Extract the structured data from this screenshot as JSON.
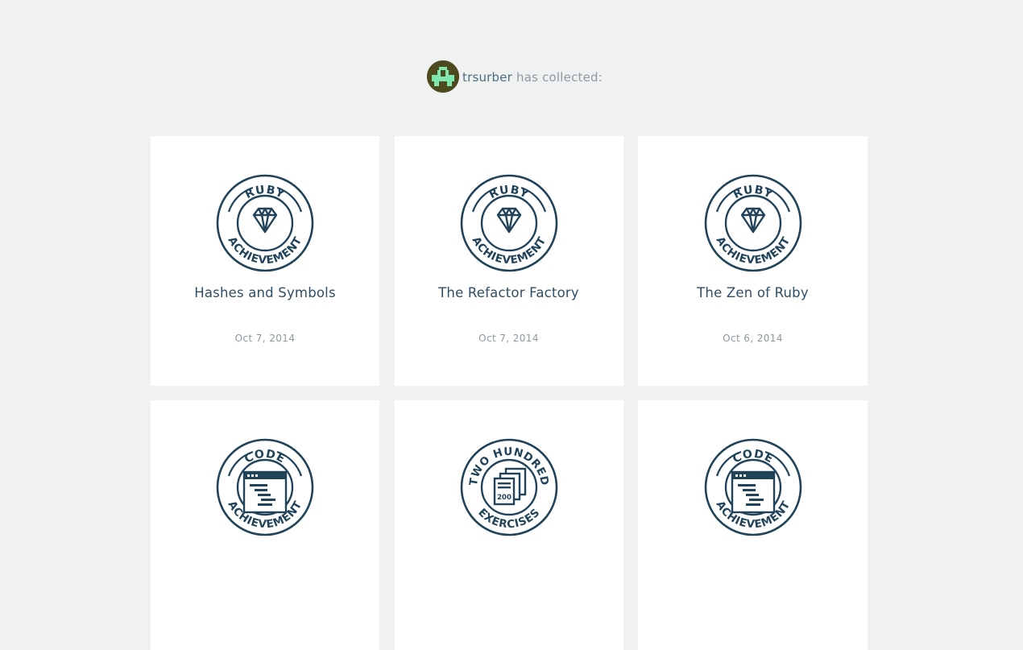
{
  "profile": {
    "username": "trsurber",
    "collected_text": "has collected:"
  },
  "colors": {
    "badge_ink": "#21435a",
    "avatar_bg": "#4c4a1e",
    "avatar_fg": "#7fe8b0",
    "page_bg": "#f0f2f1"
  },
  "achievements": [
    {
      "title": "Hashes and Symbols",
      "date": "Oct 7, 2014",
      "badge": {
        "top": "RUBY",
        "bottom": "ACHIEVEMENT",
        "icon": "diamond-icon"
      }
    },
    {
      "title": "The Refactor Factory",
      "date": "Oct 7, 2014",
      "badge": {
        "top": "RUBY",
        "bottom": "ACHIEVEMENT",
        "icon": "diamond-icon"
      }
    },
    {
      "title": "The Zen of Ruby",
      "date": "Oct 6, 2014",
      "badge": {
        "top": "RUBY",
        "bottom": "ACHIEVEMENT",
        "icon": "diamond-icon"
      }
    },
    {
      "title": "",
      "date": "",
      "badge": {
        "top": "CODE",
        "bottom": "ACHIEVEMENT",
        "icon": "code-window-icon"
      }
    },
    {
      "title": "",
      "date": "",
      "badge": {
        "top": "TWO HUNDRED",
        "bottom": "EXERCISES",
        "icon": "stacked-exercises-icon",
        "number": "200"
      }
    },
    {
      "title": "",
      "date": "",
      "badge": {
        "top": "CODE",
        "bottom": "ACHIEVEMENT",
        "icon": "code-window-icon"
      }
    }
  ]
}
